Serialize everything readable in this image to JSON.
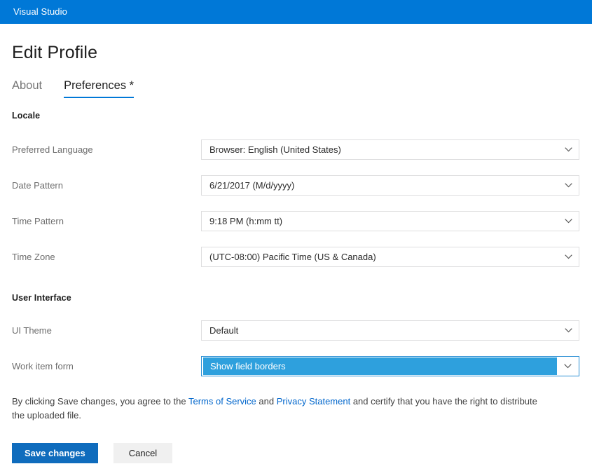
{
  "topbar": {
    "title": "Visual Studio",
    "background": "#0078d7"
  },
  "page": {
    "title": "Edit Profile"
  },
  "tabs": [
    {
      "label": "About",
      "active": false
    },
    {
      "label": "Preferences *",
      "active": true
    }
  ],
  "sections": [
    {
      "header": "Locale",
      "fields": [
        {
          "label": "Preferred Language",
          "value": "Browser: English (United States)",
          "focused": false
        },
        {
          "label": "Date Pattern",
          "value": "6/21/2017 (M/d/yyyy)",
          "focused": false
        },
        {
          "label": "Time Pattern",
          "value": "9:18 PM (h:mm tt)",
          "focused": false
        },
        {
          "label": "Time Zone",
          "value": "(UTC-08:00) Pacific Time (US & Canada)",
          "focused": false
        }
      ]
    },
    {
      "header": "User Interface",
      "fields": [
        {
          "label": "UI Theme",
          "value": "Default",
          "focused": false
        },
        {
          "label": "Work item form",
          "value": "Show field borders",
          "focused": true
        }
      ]
    }
  ],
  "legal": {
    "part1": "By clicking Save changes, you agree to the ",
    "link1": "Terms of Service",
    "part2": " and ",
    "link2": "Privacy Statement",
    "part3": " and certify that you have the right to distribute the uploaded file."
  },
  "buttons": {
    "save_label": "Save changes",
    "cancel_label": "Cancel"
  },
  "colors": {
    "accent": "#0078d7",
    "link": "#0066cc",
    "highlight": "#2ea0dd",
    "primary_button": "#0f6cbd"
  }
}
